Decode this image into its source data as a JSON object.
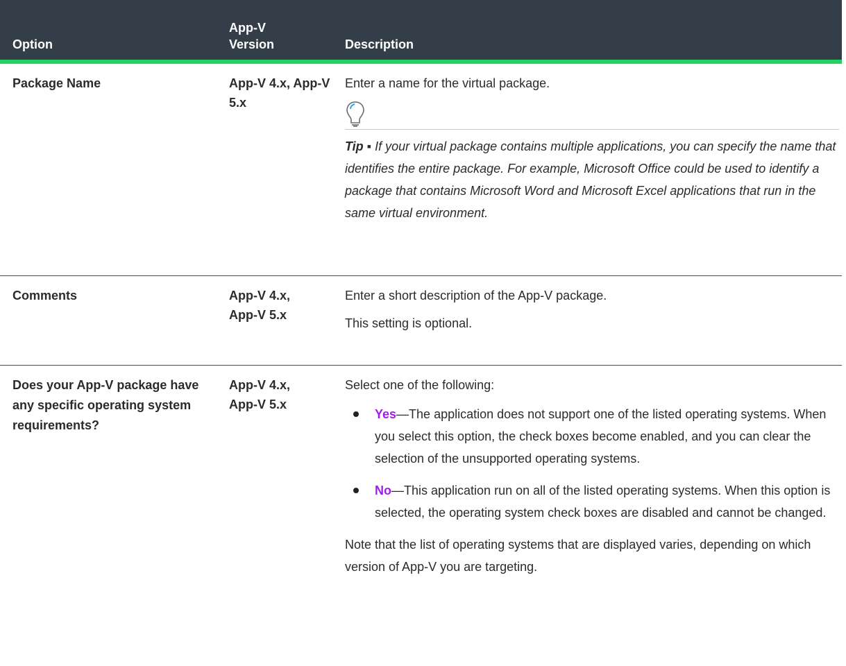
{
  "header": {
    "option": "Option",
    "version": "App-V Version",
    "description": "Description"
  },
  "rows": [
    {
      "option": "Package Name",
      "version": "App-V 4.x, App-V 5.x",
      "desc": "Enter a name for the virtual package.",
      "tip_label": "Tip",
      "tip_sep": " ▪ ",
      "tip_text": "If your virtual package contains multiple applications, you can specify the name that identifies the entire package. For example, Microsoft Office could be used to identify a package that contains Microsoft Word and Microsoft Excel applications that run in the same virtual environment."
    },
    {
      "option": "Comments",
      "version": "App-V 4.x, App-V 5.x",
      "desc": "Enter a short description of the App-V package.",
      "desc2": "This setting is optional."
    },
    {
      "option": "Does your App-V package have any specific operating system requirements?",
      "version": "App-V 4.x, App-V 5.x",
      "intro": "Select one of the following:",
      "items": [
        {
          "keyword": "Yes",
          "text": "—The application does not support one of the listed operating systems. When you select this option, the check boxes become enabled, and you can clear the selection of the unsupported operating systems."
        },
        {
          "keyword": "No",
          "text": "—This application run on all of the listed operating systems. When this option is selected, the operating system check boxes are disabled and cannot be changed."
        }
      ],
      "note": "Note that the list of operating systems that are displayed varies, depending on which version of App-V you are targeting."
    }
  ],
  "colors": {
    "header_bg": "#333e48",
    "accent_bar": "#27d264",
    "keyword": "#a01de8"
  },
  "icons": {
    "tip": "lightbulb-icon",
    "bullet": "bullet-dot"
  }
}
